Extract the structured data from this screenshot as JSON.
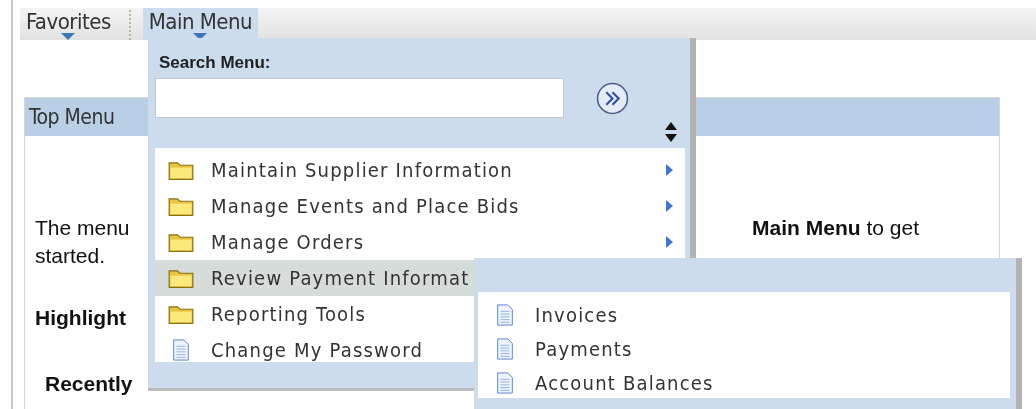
{
  "navbar": {
    "tabs": [
      {
        "label": "Favorites",
        "selected": false
      },
      {
        "label": "Main Menu",
        "selected": true
      }
    ]
  },
  "panel": {
    "title": "Top Menu",
    "intro_left": "The menu",
    "intro_right": "**Main Menu** to get",
    "intro_line2": "started.",
    "highlights": "Highlight",
    "recently": "Recently"
  },
  "main_menu": {
    "search_label": "Search Menu:",
    "items": [
      {
        "label": "Maintain Supplier Information",
        "kind": "folder",
        "arrow": true,
        "selected": false
      },
      {
        "label": "Manage Events and Place Bids",
        "kind": "folder",
        "arrow": true,
        "selected": false
      },
      {
        "label": "Manage Orders",
        "kind": "folder",
        "arrow": true,
        "selected": false
      },
      {
        "label": "Review Payment Informat",
        "kind": "folder",
        "arrow": false,
        "selected": true
      },
      {
        "label": "Reporting Tools",
        "kind": "folder",
        "arrow": false,
        "selected": false
      },
      {
        "label": "Change My Password",
        "kind": "page",
        "arrow": false,
        "selected": false
      }
    ]
  },
  "submenu": {
    "items": [
      {
        "label": "Invoices",
        "kind": "page"
      },
      {
        "label": "Payments",
        "kind": "page"
      },
      {
        "label": "Account Balances",
        "kind": "page"
      }
    ]
  }
}
